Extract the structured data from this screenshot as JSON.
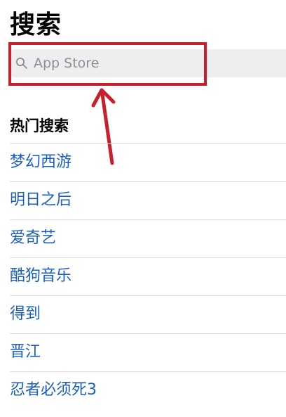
{
  "header": {
    "title": "搜索"
  },
  "search": {
    "placeholder": "App Store"
  },
  "trending": {
    "heading": "热门搜索",
    "items": [
      {
        "label": "梦幻西游"
      },
      {
        "label": "明日之后"
      },
      {
        "label": "爱奇艺"
      },
      {
        "label": "酷狗音乐"
      },
      {
        "label": "得到"
      },
      {
        "label": "晋江"
      },
      {
        "label": "忍者必须死3"
      }
    ]
  },
  "colors": {
    "link": "#1a5fbf",
    "annotation": "#c8202a",
    "search_background": "#eeeef0",
    "placeholder": "#8e8e93"
  },
  "icons": {
    "search": "search-icon"
  }
}
